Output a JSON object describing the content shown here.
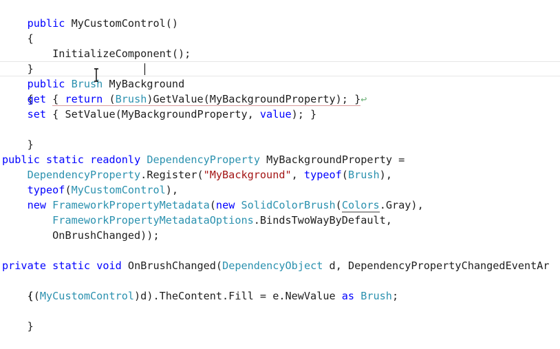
{
  "code": {
    "l1": {
      "kw": "public",
      "rest": " MyCustomControl()"
    },
    "l2": "{",
    "l3": "    InitializeComponent();",
    "l4": "}",
    "l5": {
      "kw": "public",
      "ty": "Brush",
      "name": "MyBackground"
    },
    "l6": "{",
    "l7": {
      "get": "get",
      "brace_open": "{ ",
      "ret": "return",
      "cast_open": " (",
      "cast_type": "Brush",
      "rest": ")GetValue(MyBackgroundProperty); }",
      "glyph": "↩"
    },
    "l8": {
      "set": "set",
      "rest_a": " { SetValue(MyBackgroundProperty, ",
      "value_kw": "value",
      "rest_b": "); }"
    },
    "l9": "}",
    "l10": {
      "kw1": "public",
      "kw2": "static",
      "kw3": "readonly",
      "ty": "DependencyProperty",
      "rest": " MyBackgroundProperty ="
    },
    "l11": {
      "ty": "DependencyProperty",
      "mid": ".Register(",
      "str": "\"MyBackground\"",
      "comma": ", ",
      "kw": "typeof",
      "paren_open": "(",
      "ty2": "Brush",
      "end": "),"
    },
    "l12": {
      "kw": "typeof",
      "paren_open": "(",
      "ty": "MyCustomControl",
      "end": "),"
    },
    "l13": {
      "kw1": "new",
      "ty1": "FrameworkPropertyMetadata",
      "mid": "(",
      "kw2": "new",
      "ty2": "SolidColorBrush",
      "paren": "(",
      "ty3": "Colors",
      "end": ".Gray),"
    },
    "l14": {
      "ty": "FrameworkPropertyMetadataOptions",
      "end": ".BindsTwoWayByDefault,"
    },
    "l15": "OnBrushChanged));",
    "l16": {
      "kw1": "private",
      "kw2": "static",
      "kw3": "void",
      "name": " OnBrushChanged(",
      "ty1": "DependencyObject",
      "mid": " d, DependencyPropertyChangedEventAr"
    },
    "l17": "{",
    "l18": {
      "pre": "    ((",
      "ty1": "MyCustomControl",
      "mid": ")d).TheContent.Fill = e.NewValue ",
      "kw": "as",
      "sp": " ",
      "ty2": "Brush",
      "end": ";"
    },
    "l19": "}"
  }
}
